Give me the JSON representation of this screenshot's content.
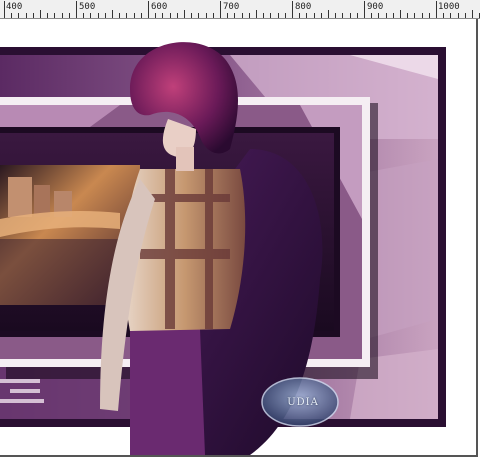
{
  "ruler": {
    "labels": [
      "400",
      "500",
      "600",
      "700",
      "800",
      "900",
      "1000"
    ]
  },
  "watermark": {
    "text": "UDIA"
  },
  "colors": {
    "accent_purple": "#6a2c6e",
    "dark_purple": "#2b0f33",
    "mauve": "#b07aa7",
    "city_glow": "#e0a070"
  }
}
